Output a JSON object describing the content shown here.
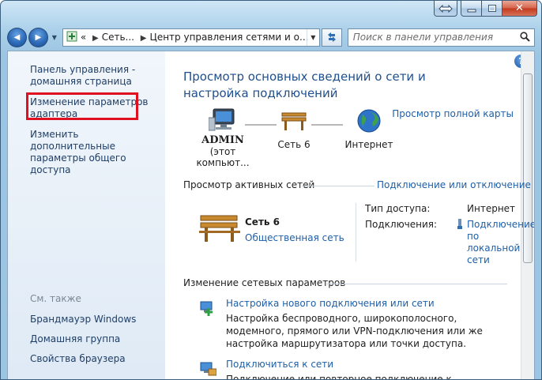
{
  "window": {
    "caption": {
      "close_glyph": "✕"
    }
  },
  "navbar": {
    "back_glyph": "◀",
    "forward_glyph": "▶",
    "address_parts": [
      "«",
      "Сеть...",
      "Центр управления сетями и о..."
    ],
    "search_placeholder": "Поиск в панели управления"
  },
  "sidebar": {
    "items": [
      {
        "label": "Панель управления - домашняя страница"
      },
      {
        "label": "Изменение параметров адаптера"
      },
      {
        "label": "Изменить дополнительные параметры общего доступа"
      }
    ],
    "see_also_title": "См. также",
    "see_also": [
      {
        "label": "Брандмауэр Windows"
      },
      {
        "label": "Домашняя группа"
      },
      {
        "label": "Свойства браузера"
      }
    ]
  },
  "main": {
    "help_glyph": "?",
    "heading": "Просмотр основных сведений о сети и настройка подключений",
    "full_map_link": "Просмотр полной карты",
    "map": {
      "computer_name": "ADMIN",
      "computer_sub": "(этот компьют...",
      "network_label": "Сеть  6",
      "internet_label": "Интернет"
    },
    "active_networks": {
      "title": "Просмотр активных сетей",
      "link": "Подключение или отключение",
      "network_name": "Сеть  6",
      "network_type": "Общественная сеть",
      "access_type_label": "Тип доступа:",
      "access_type_value": "Интернет",
      "connections_label": "Подключения:",
      "connection_link": "Подключение по локальной сети"
    },
    "change_settings": {
      "title": "Изменение сетевых параметров",
      "tasks": [
        {
          "title": "Настройка нового подключения или сети",
          "desc": "Настройка беспроводного, широкополосного, модемного, прямого или VPN-подключения или же настройка маршрутизатора или точки доступа."
        },
        {
          "title": "Подключиться к сети",
          "desc": "Подключение или повторное подключение к беспроводному,"
        }
      ]
    }
  }
}
